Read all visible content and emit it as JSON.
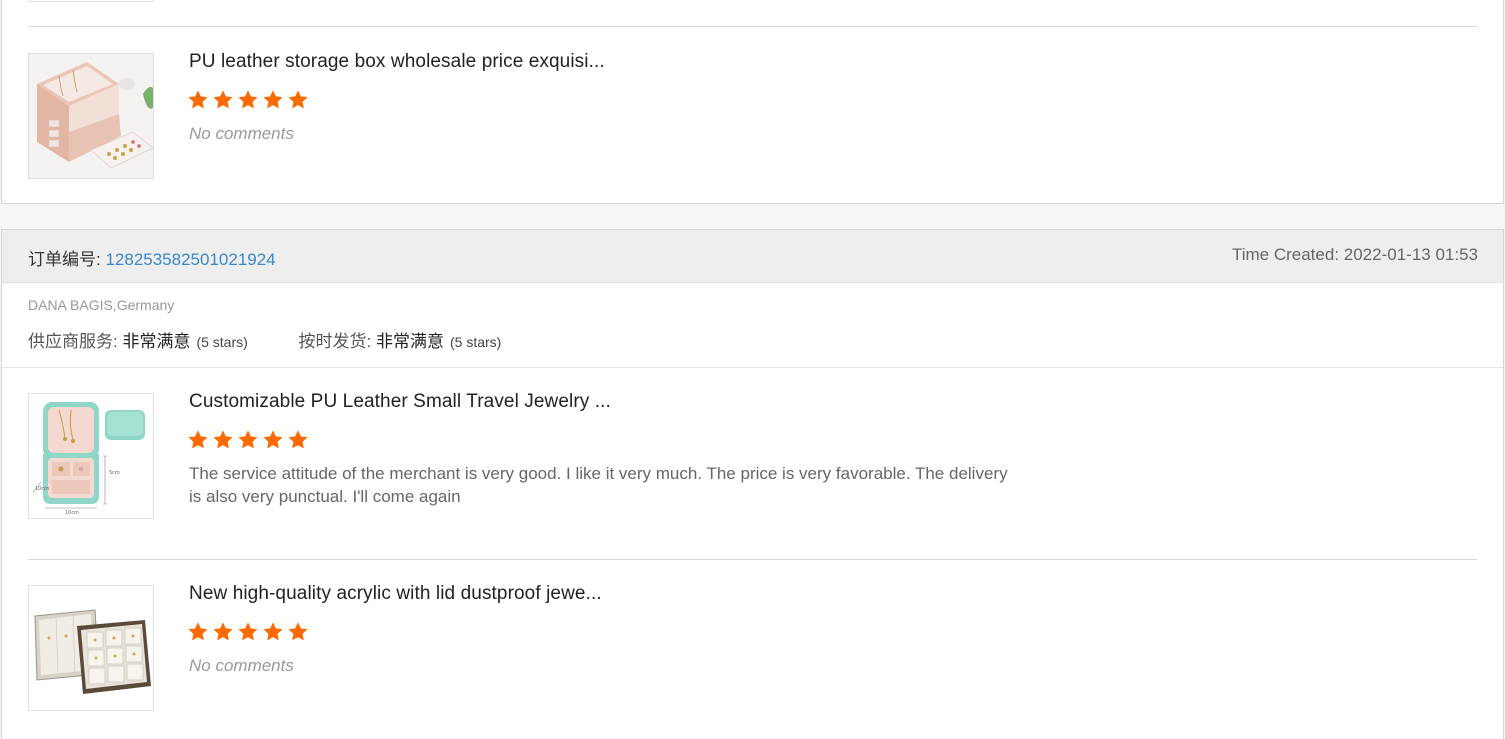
{
  "colors": {
    "star": "#ff6a00",
    "order_number": "#3a87c8",
    "header_bg": "#eeeeee"
  },
  "card1": {
    "products": [
      {
        "title": "PU leather storage box wholesale price exquisi...",
        "rating": 5,
        "max_rating": 5,
        "comment": "No comments",
        "image": "pink-jewelry-box"
      }
    ]
  },
  "card2": {
    "order": {
      "number_label": "订单编号: ",
      "number": "128253582501021924",
      "time_label": "Time Created: ",
      "time": "2022-01-13 01:53"
    },
    "buyer": "DANA BAGIS,Germany",
    "ratings": [
      {
        "label": "供应商服务: ",
        "value": "非常满意",
        "stars": "(5 stars)"
      },
      {
        "label": "按时发货: ",
        "value": "非常满意",
        "stars": "(5 stars)"
      }
    ],
    "products": [
      {
        "title": "Customizable PU Leather Small Travel Jewelry ...",
        "rating": 5,
        "max_rating": 5,
        "comment": "The service attitude of the merchant is very good. I like it very much. The price is very favorable. The delivery is also very punctual. I'll come again",
        "image": "mint-travel-jewelry-box"
      },
      {
        "title": "New high-quality acrylic with lid dustproof jewe...",
        "rating": 5,
        "max_rating": 5,
        "comment": "No comments",
        "image": "acrylic-jewelry-tray"
      }
    ]
  }
}
